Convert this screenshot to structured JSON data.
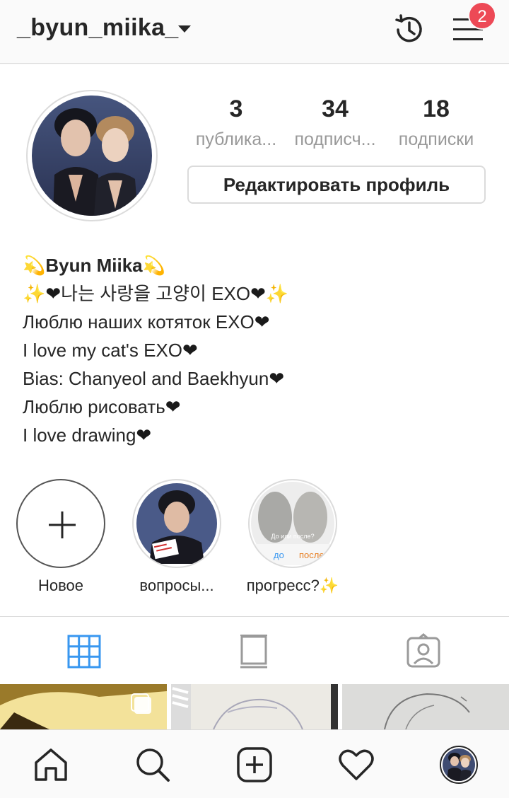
{
  "header": {
    "username": "_byun_miika_",
    "notifications_count": "2"
  },
  "profile": {
    "stats": [
      {
        "value": "3",
        "label": "публика..."
      },
      {
        "value": "34",
        "label": "подписч..."
      },
      {
        "value": "18",
        "label": "подписки"
      }
    ],
    "edit_button": "Редактировать профиль",
    "bio": {
      "name": "Byun Miika",
      "lines": [
        "나는 사랑을 고양이 EXO",
        "Люблю наших котяток EXO",
        "I love my cat's EXO",
        "Bias: Chanyeol and Baekhyun",
        "Люблю рисовать",
        "I love drawing"
      ]
    }
  },
  "highlights": [
    {
      "label": "Новое"
    },
    {
      "label": "вопросы..."
    },
    {
      "label": "прогресс?"
    }
  ],
  "highlight_overlay": {
    "question": "До или после?",
    "before": "до",
    "after": "после"
  },
  "tabs": [
    "grid-icon",
    "feed-icon",
    "tagged-icon"
  ],
  "bottom_nav": [
    "home-icon",
    "search-icon",
    "add-post-icon",
    "heart-icon",
    "profile-avatar"
  ],
  "colors": {
    "accent": "#3897f0",
    "badge": "#ed4956",
    "text": "#262626",
    "muted": "#999999",
    "border": "#dbdbdb"
  }
}
